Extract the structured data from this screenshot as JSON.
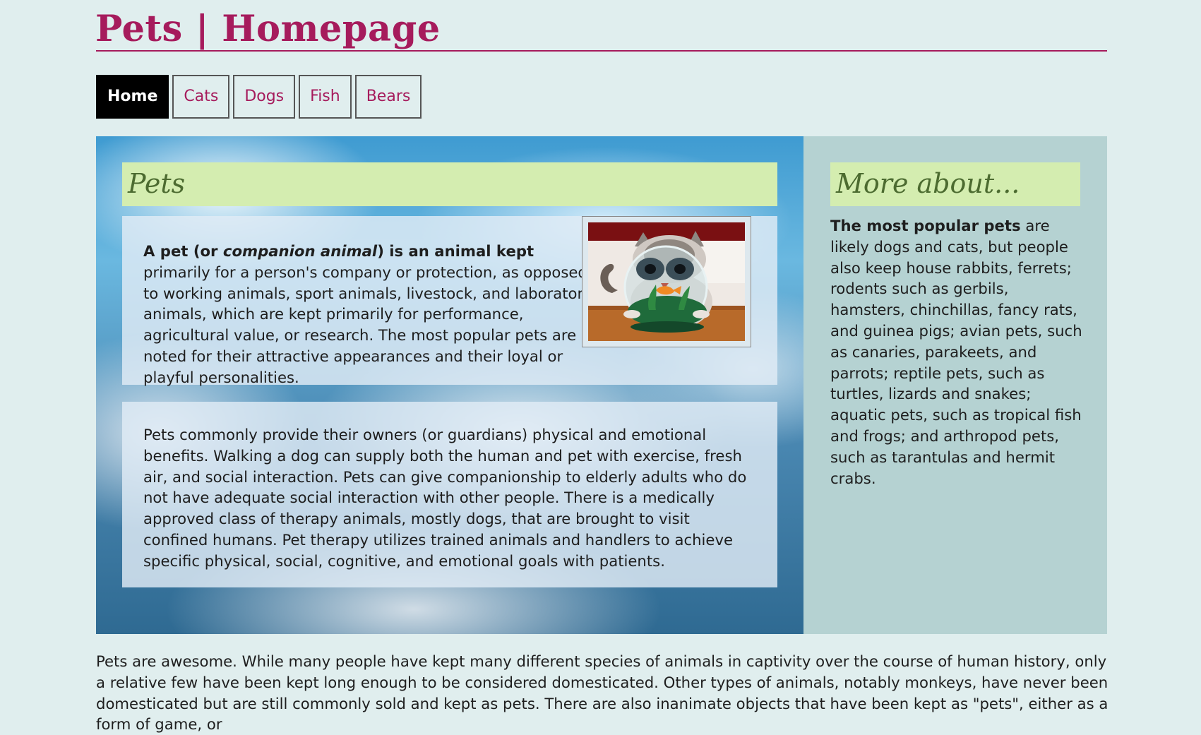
{
  "header": {
    "title": "Pets | Homepage"
  },
  "nav": {
    "items": [
      {
        "label": "Home",
        "active": true
      },
      {
        "label": "Cats",
        "active": false
      },
      {
        "label": "Dogs",
        "active": false
      },
      {
        "label": "Fish",
        "active": false
      },
      {
        "label": "Bears",
        "active": false
      }
    ]
  },
  "main": {
    "heading": "Pets",
    "intro": {
      "t1": "A pet (or ",
      "t2": "companion animal",
      "t3": ") is an animal kept",
      "t4": " primarily for a person's company or protection, as opposed to working animals, sport animals, livestock, and laboratory animals, which are kept primarily for performance, agricultural value, or research. The most popular pets are noted for their attractive appearances and their loyal or playful personalities."
    },
    "image": {
      "icon": "cat-with-fishbowl-photo"
    },
    "benefits": "Pets commonly provide their owners (or guardians) physical and emotional benefits. Walking a dog can supply both the human and pet with exercise, fresh air, and social interaction. Pets can give companionship to elderly adults who do not have adequate social interaction with other people. There is a medically approved class of therapy animals, mostly dogs, that are brought to visit confined humans. Pet therapy utilizes trained animals and handlers to achieve specific physical, social, cognitive, and emotional goals with patients."
  },
  "aside": {
    "heading": "More about...",
    "lead": "The most popular pets",
    "body": " are likely dogs and cats, but people also keep house rabbits, ferrets; rodents such as gerbils, hamsters, chinchillas, fancy rats, and guinea pigs; avian pets, such as canaries, parakeets, and parrots; reptile pets, such as turtles, lizards and snakes; aquatic pets, such as tropical fish and frogs; and arthropod pets, such as tarantulas and hermit crabs."
  },
  "footer": {
    "text": "Pets are awesome. While many people have kept many different species of animals in captivity over the course of human history, only a relative few have been kept long enough to be considered domesticated. Other types of animals, notably monkeys, have never been domesticated but are still commonly sold and kept as pets. There are also inanimate objects that have been kept as \"pets\", either as a form of game, or"
  },
  "colors": {
    "accent": "#a61b5c",
    "background": "#e0eeee",
    "heading_bg": "#d4edb0",
    "heading_text": "#4c6b30",
    "aside_bg": "#b5d2d2"
  }
}
